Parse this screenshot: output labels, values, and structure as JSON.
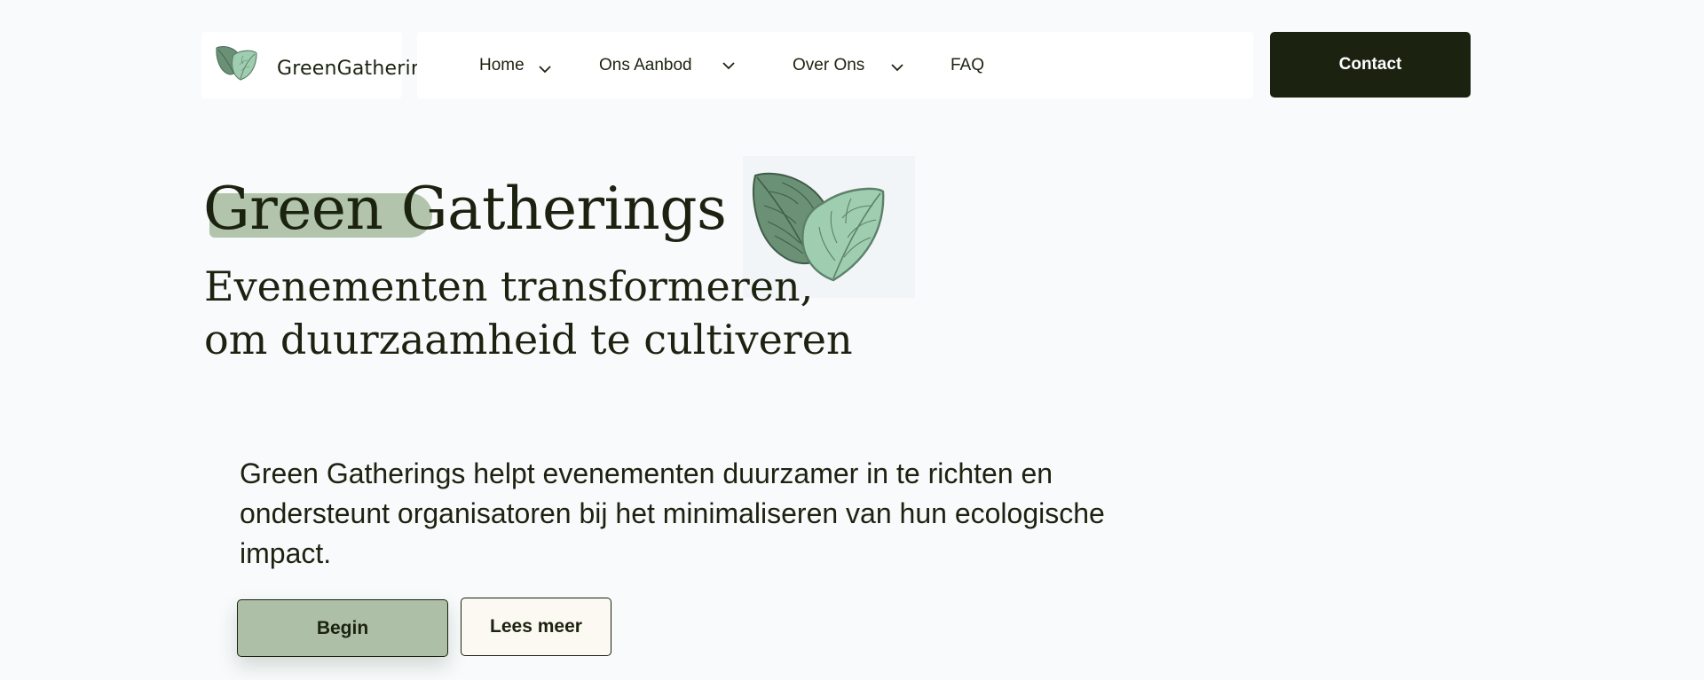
{
  "brand": {
    "name": "GreenGatherings",
    "logo_icon": "leaves-icon"
  },
  "nav": {
    "items": [
      {
        "label": "Home",
        "has_dropdown": true
      },
      {
        "label": "Ons Aanbod",
        "has_dropdown": true
      },
      {
        "label": "Over Ons",
        "has_dropdown": true
      },
      {
        "label": "FAQ",
        "has_dropdown": false
      }
    ]
  },
  "header": {
    "contact_label": "Contact"
  },
  "hero": {
    "title": "Green Gatherings",
    "subtitle_line1": "Evenementen transformeren,",
    "subtitle_line2": "om duurzaamheid te cultiveren",
    "description": "Green Gatherings helpt evenementen duurzamer in te richten en ondersteunt organisatoren bij het minimaliseren van hun ecologische impact.",
    "primary_button": "Begin",
    "secondary_button": "Lees meer",
    "illustration_icon": "leaves-icon"
  },
  "colors": {
    "background": "#f8fafc",
    "dark": "#1b2310",
    "sage": "#aebfa7",
    "cream": "#fcf8f2",
    "leaf_dark": "#6a9175",
    "leaf_light": "#9fcdb0"
  }
}
